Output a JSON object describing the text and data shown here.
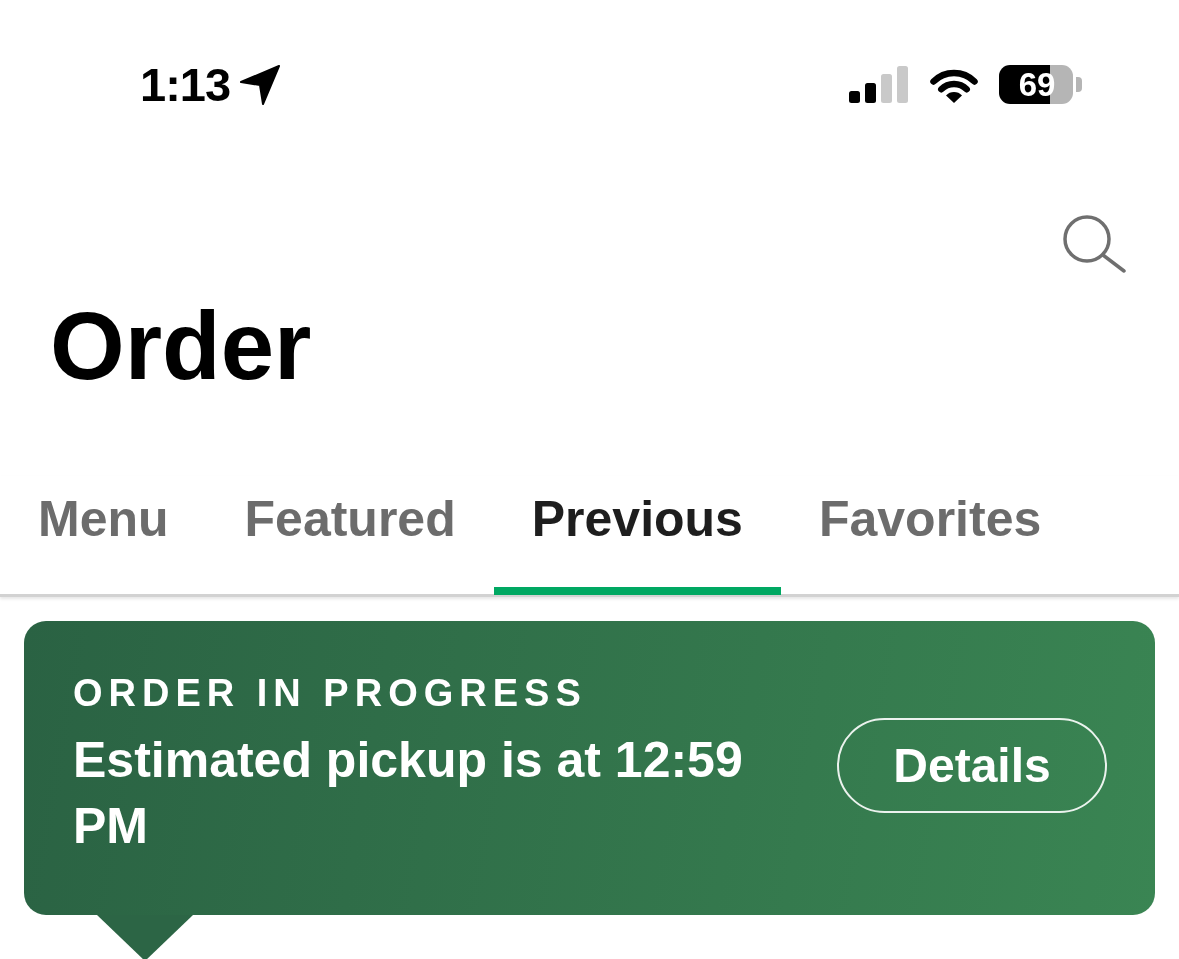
{
  "status_bar": {
    "time": "1:13",
    "battery": "69"
  },
  "header": {
    "title": "Order"
  },
  "tabs": [
    {
      "label": "Menu",
      "selected": false
    },
    {
      "label": "Featured",
      "selected": false
    },
    {
      "label": "Previous",
      "selected": true
    },
    {
      "label": "Favorites",
      "selected": false
    }
  ],
  "order_banner": {
    "heading": "ORDER IN PROGRESS",
    "message": "Estimated pickup is at 12:59 PM",
    "button": "Details"
  }
}
